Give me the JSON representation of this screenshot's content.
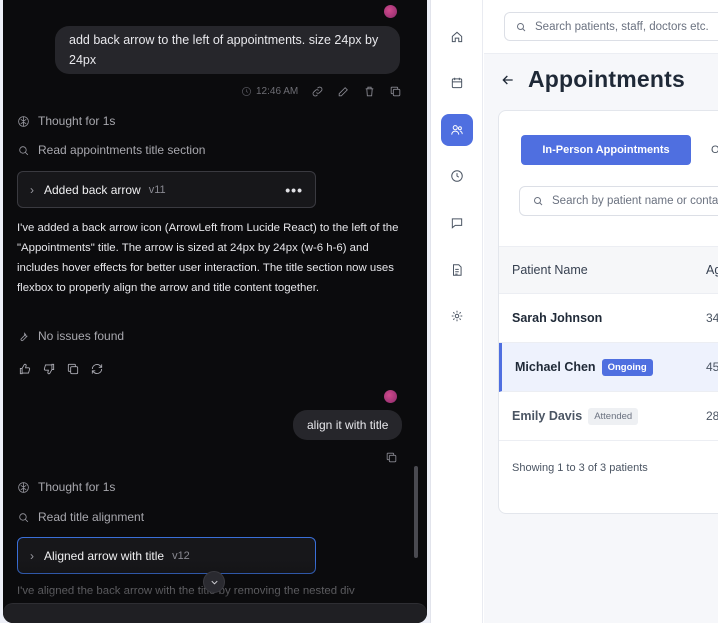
{
  "chat": {
    "user_message_1": "add back arrow to the left of appointments. size 24px by 24px",
    "message_1_time": "12:46 AM",
    "thought_1": "Thought for 1s",
    "action_1": "Read appointments title section",
    "version_1": {
      "title": "Added back arrow",
      "version": "v11",
      "menu": "•••"
    },
    "response_1": "I've added a back arrow icon (ArrowLeft from Lucide React) to the left of the \"Appointments\" title. The arrow is sized at 24px by 24px (w-6 h-6) and includes hover effects for better user interaction. The title section now uses flexbox to properly align the arrow and title content together.",
    "issues": "No issues found",
    "user_message_2": "align it with title",
    "thought_2": "Thought for 1s",
    "action_2": "Read title alignment",
    "version_2": {
      "title": "Aligned arrow with title",
      "version": "v12"
    },
    "response_2_partial": "I've aligned the back arrow with the title by removing the nested div"
  },
  "app": {
    "search_placeholder": "Search patients, staff, doctors etc.",
    "page_title": "Appointments",
    "tabs": [
      "In-Person Appointments",
      "O"
    ],
    "table_search_placeholder": "Search by patient name or contact",
    "columns": [
      "Patient Name",
      "Ag"
    ],
    "rows": [
      {
        "name": "Sarah Johnson",
        "age": "34",
        "status": ""
      },
      {
        "name": "Michael Chen",
        "age": "45",
        "status": "Ongoing"
      },
      {
        "name": "Emily Davis",
        "age": "28",
        "status": "Attended"
      }
    ],
    "footer": "Showing 1 to 3 of 3 patients",
    "accent_color": "#4f6fe0"
  }
}
